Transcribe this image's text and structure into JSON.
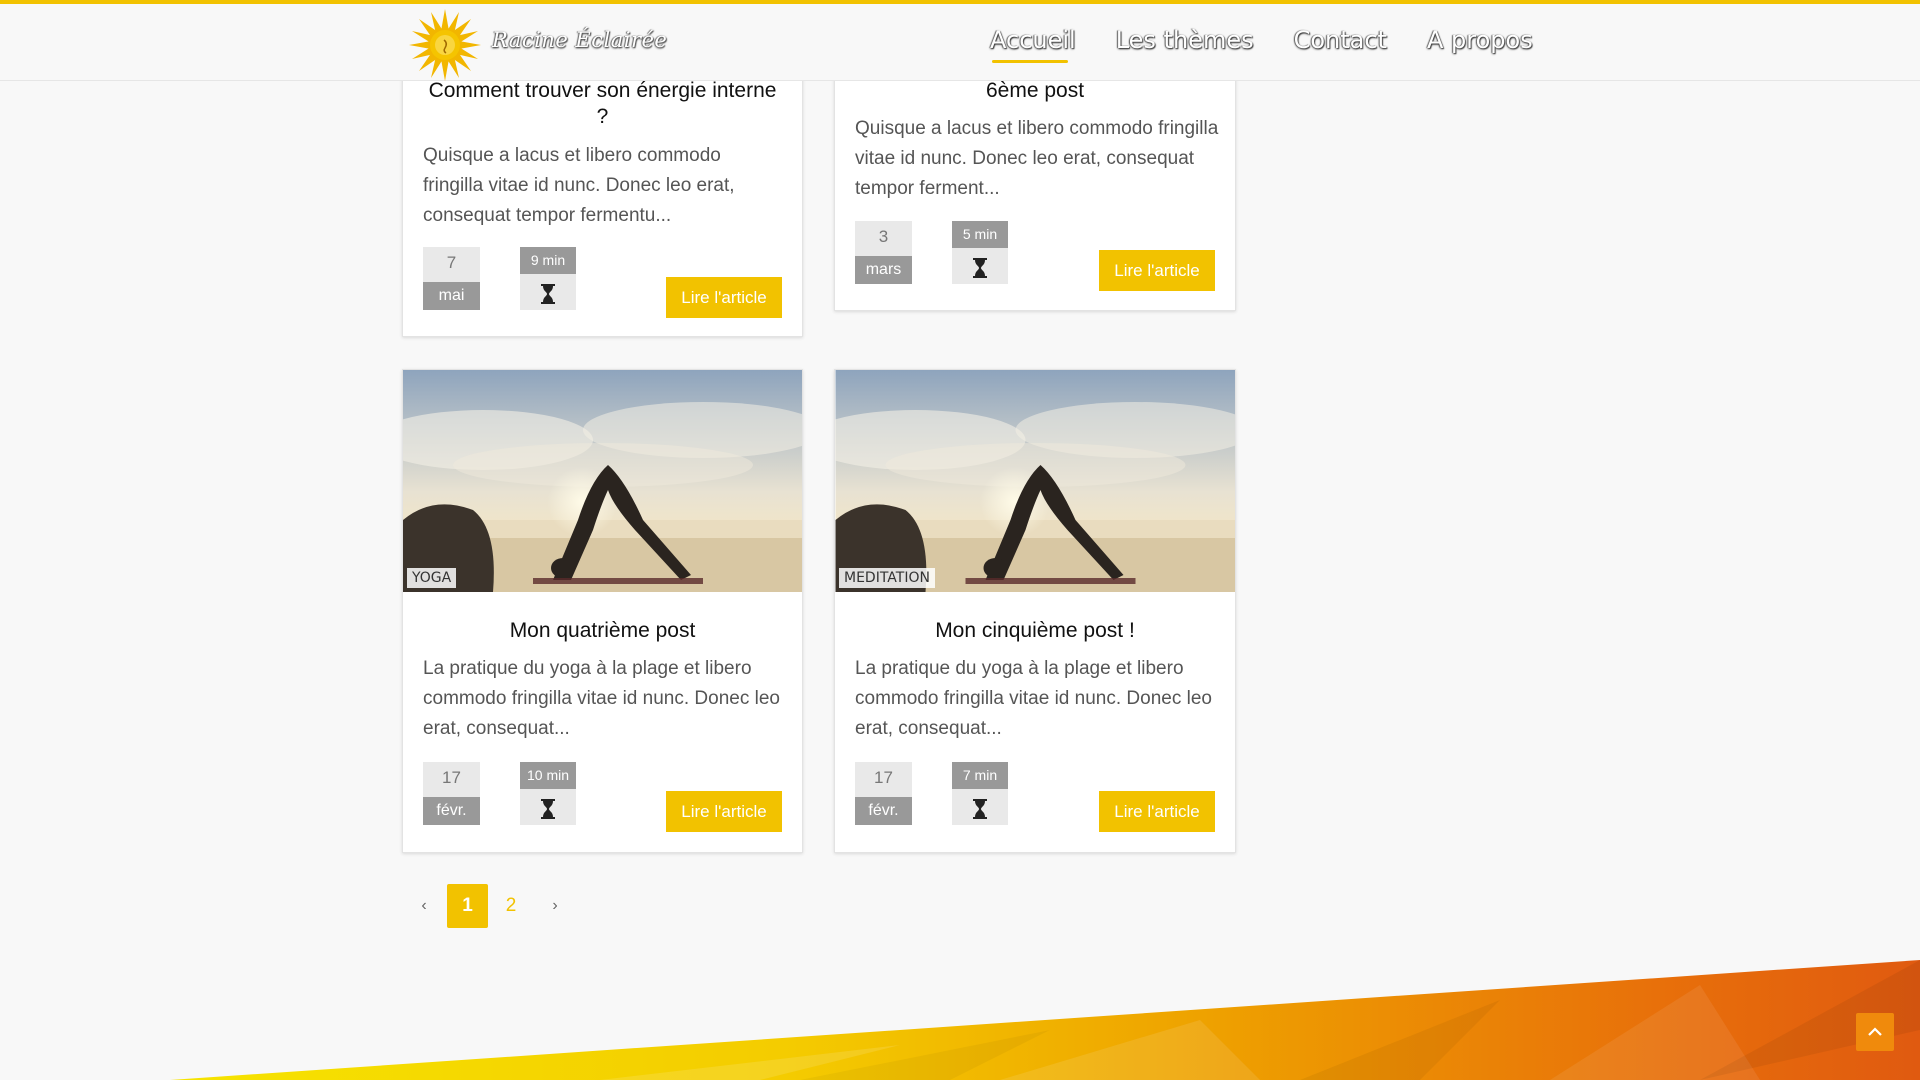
{
  "header": {
    "brand": "Racine Éclairée",
    "nav": [
      "Accueil",
      "Les thèmes",
      "Contact",
      "A propos"
    ],
    "active_index": 0
  },
  "cards": [
    {
      "title": "Comment trouver son énergie interne ?",
      "excerpt": "Quisque a lacus et libero commodo fringilla vitae id nunc. Donec leo erat, consequat tempor fermentu...",
      "day": "7",
      "month": "mai",
      "read_time": "9 min",
      "button": "Lire l'article"
    },
    {
      "title": "6ème post",
      "excerpt": "Quisque a lacus et libero commodo fringilla vitae id nunc. Donec leo erat, consequat tempor ferment...",
      "day": "3",
      "month": "mars",
      "read_time": "5 min",
      "button": "Lire l'article"
    },
    {
      "category": "YOGA",
      "title": "Mon quatrième post",
      "excerpt": "La pratique du yoga à la plage et libero commodo fringilla vitae id nunc. Donec leo erat, consequat...",
      "day": "17",
      "month": "févr.",
      "read_time": "10 min",
      "button": "Lire l'article"
    },
    {
      "category": "MEDITATION",
      "title": "Mon cinquième post !",
      "excerpt": "La pratique du yoga à la plage et libero commodo fringilla vitae id nunc. Donec leo erat, consequat...",
      "day": "17",
      "month": "févr.",
      "read_time": "7 min",
      "button": "Lire l'article"
    }
  ],
  "pagination": {
    "prev": "‹",
    "next": "›",
    "pages": [
      "1",
      "2"
    ],
    "current": "1"
  },
  "colors": {
    "accent": "#f2c200",
    "badge_grey": "#999999",
    "footer_orange": "#e8620a"
  },
  "icons": {
    "logo": "sun-icon",
    "time": "hourglass-icon",
    "scroll_top": "chevron-up-icon"
  }
}
